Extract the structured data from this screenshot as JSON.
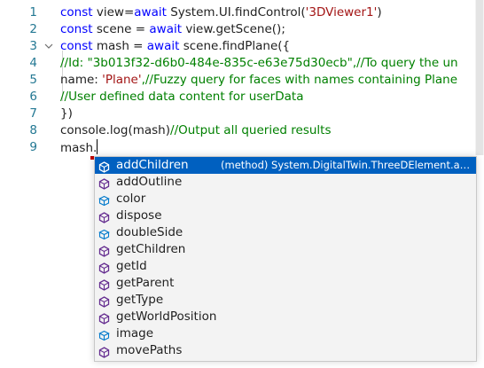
{
  "editor": {
    "lines": [
      {
        "num": "1",
        "fold": "",
        "tokens": [
          {
            "t": "const ",
            "c": "kw"
          },
          {
            "t": "view=",
            "c": ""
          },
          {
            "t": "await ",
            "c": "kw"
          },
          {
            "t": "System.UI.findControl(",
            "c": ""
          },
          {
            "t": "'3DViewer1'",
            "c": "str"
          },
          {
            "t": ")",
            "c": ""
          }
        ]
      },
      {
        "num": "2",
        "fold": "",
        "tokens": [
          {
            "t": "const ",
            "c": "kw"
          },
          {
            "t": "scene = ",
            "c": ""
          },
          {
            "t": "await ",
            "c": "kw"
          },
          {
            "t": "view.getScene();",
            "c": ""
          }
        ]
      },
      {
        "num": "3",
        "fold": "v",
        "tokens": [
          {
            "t": "const ",
            "c": "kw"
          },
          {
            "t": "mash = ",
            "c": ""
          },
          {
            "t": "await ",
            "c": "kw"
          },
          {
            "t": "scene.findPlane({",
            "c": ""
          }
        ]
      },
      {
        "num": "4",
        "fold": "",
        "tokens": [
          {
            "t": " //Id: \"3b013f32-d6b0-484e-835c-e63e75d30ecb\",//To query the un",
            "c": "cm"
          }
        ]
      },
      {
        "num": "5",
        "fold": "",
        "tokens": [
          {
            "t": "  name: ",
            "c": ""
          },
          {
            "t": "'Plane'",
            "c": "str"
          },
          {
            "t": ",//Fuzzy query for faces with names containing Plane",
            "c": "cm"
          }
        ]
      },
      {
        "num": "6",
        "fold": "",
        "tokens": [
          {
            "t": "  //User defined data content for userData",
            "c": "cm"
          }
        ]
      },
      {
        "num": "7",
        "fold": "",
        "tokens": [
          {
            "t": "})",
            "c": ""
          }
        ]
      },
      {
        "num": "8",
        "fold": "",
        "tokens": [
          {
            "t": "console.log(mash)",
            "c": ""
          },
          {
            "t": "//Output all queried results",
            "c": "cm"
          }
        ]
      },
      {
        "num": "9",
        "fold": "",
        "tokens": [
          {
            "t": "mash.",
            "c": ""
          }
        ]
      }
    ]
  },
  "suggest": {
    "selected_detail": "(method) System.DigitalTwin.ThreeDElement.a…",
    "items": [
      {
        "label": "addChildren",
        "icon": "method-icon",
        "selected": true
      },
      {
        "label": "addOutline",
        "icon": "method-icon",
        "selected": false
      },
      {
        "label": "color",
        "icon": "property-icon",
        "selected": false
      },
      {
        "label": "dispose",
        "icon": "method-icon",
        "selected": false
      },
      {
        "label": "doubleSide",
        "icon": "property-icon",
        "selected": false
      },
      {
        "label": "getChildren",
        "icon": "method-icon",
        "selected": false
      },
      {
        "label": "getId",
        "icon": "method-icon",
        "selected": false
      },
      {
        "label": "getParent",
        "icon": "method-icon",
        "selected": false
      },
      {
        "label": "getType",
        "icon": "method-icon",
        "selected": false
      },
      {
        "label": "getWorldPosition",
        "icon": "method-icon",
        "selected": false
      },
      {
        "label": "image",
        "icon": "property-icon",
        "selected": false
      },
      {
        "label": "movePaths",
        "icon": "method-icon",
        "selected": false
      }
    ]
  },
  "colors": {
    "keyword": "#0000ff",
    "string": "#a31515",
    "comment": "#008000",
    "line_number": "#237893",
    "selection": "#0060c0",
    "method_icon": "#652d90",
    "property_icon": "#007acc"
  }
}
